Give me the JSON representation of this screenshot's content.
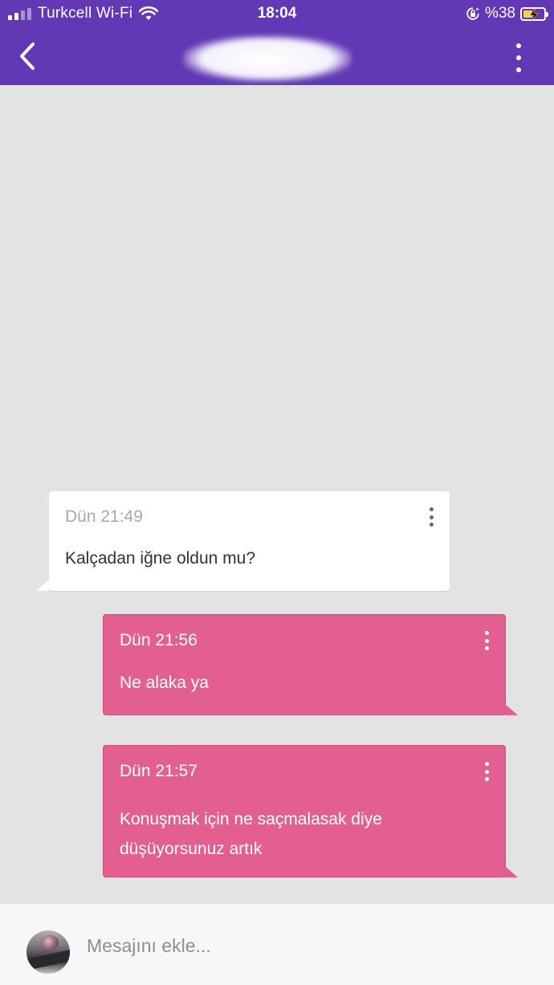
{
  "status_bar": {
    "carrier": "Turkcell Wi-Fi",
    "time": "18:04",
    "battery_percent": "%38",
    "battery_level": 0.38,
    "battery_fill_color": "#f5d142"
  },
  "header": {
    "background_color": "#6139b4",
    "title": ""
  },
  "messages": [
    {
      "direction": "incoming",
      "timestamp": "Dün 21:49",
      "text": "Kalçadan iğne oldun mu?"
    },
    {
      "direction": "outgoing",
      "timestamp": "Dün 21:56",
      "text": "Ne alaka ya"
    },
    {
      "direction": "outgoing",
      "timestamp": "Dün 21:57",
      "text": "Konuşmak için ne saçmalasak diye düşüyorsunuz artık"
    }
  ],
  "composer": {
    "placeholder": "Mesajını ekle...",
    "value": ""
  },
  "colors": {
    "outgoing_bubble": "#e35e91",
    "incoming_bubble": "#ffffff",
    "chat_background": "#e3e3e3"
  }
}
